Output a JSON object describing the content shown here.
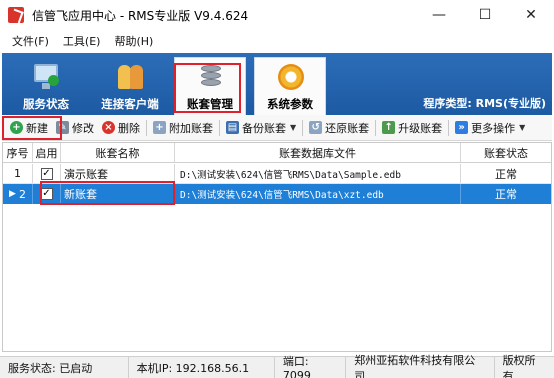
{
  "window": {
    "title": "信管飞应用中心 - RMS专业版 V9.4.624",
    "minimize_glyph": "—",
    "maximize_glyph": "☐",
    "close_glyph": "✕"
  },
  "menu": {
    "file": "文件(F)",
    "tools": "工具(E)",
    "help": "帮助(H)"
  },
  "ribbon": {
    "tabs": [
      {
        "label": "服务状态",
        "icon": "monitor-check-icon"
      },
      {
        "label": "连接客户端",
        "icon": "users-icon"
      },
      {
        "label": "账套管理",
        "icon": "database-icon",
        "active": true
      },
      {
        "label": "系统参数",
        "icon": "gear-icon"
      }
    ],
    "program_type": "程序类型: RMS(专业版)"
  },
  "toolbar": {
    "new": "新建",
    "edit": "修改",
    "delete": "删除",
    "attach": "附加账套",
    "backup": "备份账套",
    "restore": "还原账套",
    "upgrade": "升级账套",
    "more": "更多操作"
  },
  "table": {
    "columns": [
      "序号",
      "启用",
      "账套名称",
      "账套数据库文件",
      "账套状态"
    ],
    "rows": [
      {
        "index": "1",
        "enabled_mark": "✓",
        "name": "演示账套",
        "file": "D:\\测试安装\\624\\信管飞RMS\\Data\\Sample.edb",
        "status": "正常"
      },
      {
        "index": "2",
        "enabled_mark": "✓",
        "name": "新账套",
        "file": "D:\\测试安装\\624\\信管飞RMS\\Data\\xzt.edb",
        "status": "正常",
        "selected": true
      }
    ],
    "selected_pointer": "▶"
  },
  "status": {
    "service": "服务状态: 已启动",
    "ip": "本机IP: 192.168.56.1",
    "port": "端口: 7099",
    "company": "郑州亚拓软件科技有限公司",
    "copyright": "版权所有"
  },
  "colors": {
    "ribbon_blue": "#1c5aa3",
    "selection_blue": "#1f7fd6",
    "highlight_red": "#e0202a"
  }
}
